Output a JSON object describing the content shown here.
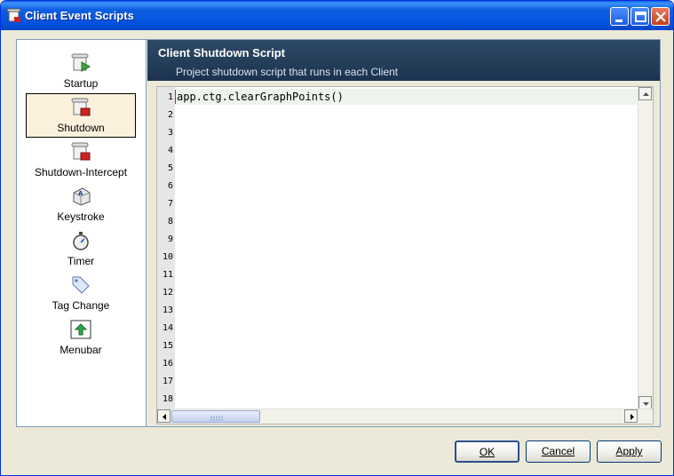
{
  "window": {
    "title": "Client Event Scripts",
    "icon": "scroll-icon"
  },
  "sidebar": {
    "items": [
      {
        "label": "Startup",
        "icon": "scroll-play-icon"
      },
      {
        "label": "Shutdown",
        "icon": "scroll-stop-icon",
        "selected": true
      },
      {
        "label": "Shutdown-Intercept",
        "icon": "scroll-stop-icon"
      },
      {
        "label": "Keystroke",
        "icon": "key-icon"
      },
      {
        "label": "Timer",
        "icon": "stopwatch-icon"
      },
      {
        "label": "Tag Change",
        "icon": "tag-icon"
      },
      {
        "label": "Menubar",
        "icon": "menubar-icon"
      }
    ]
  },
  "panel": {
    "title": "Client Shutdown Script",
    "subtitle": "Project shutdown script that runs in each Client"
  },
  "editor": {
    "line_numbers": [
      "1",
      "2",
      "3",
      "4",
      "5",
      "6",
      "7",
      "8",
      "9",
      "10",
      "11",
      "12",
      "13",
      "14",
      "15",
      "16",
      "17",
      "18"
    ],
    "code": "app.ctg.clearGraphPoints()"
  },
  "buttons": {
    "ok": "OK",
    "cancel": "Cancel",
    "apply": "Apply"
  },
  "colors": {
    "titlebar": "#0554e0",
    "panel_header": "#1c334f",
    "selected_bg": "#fbf1dc"
  }
}
